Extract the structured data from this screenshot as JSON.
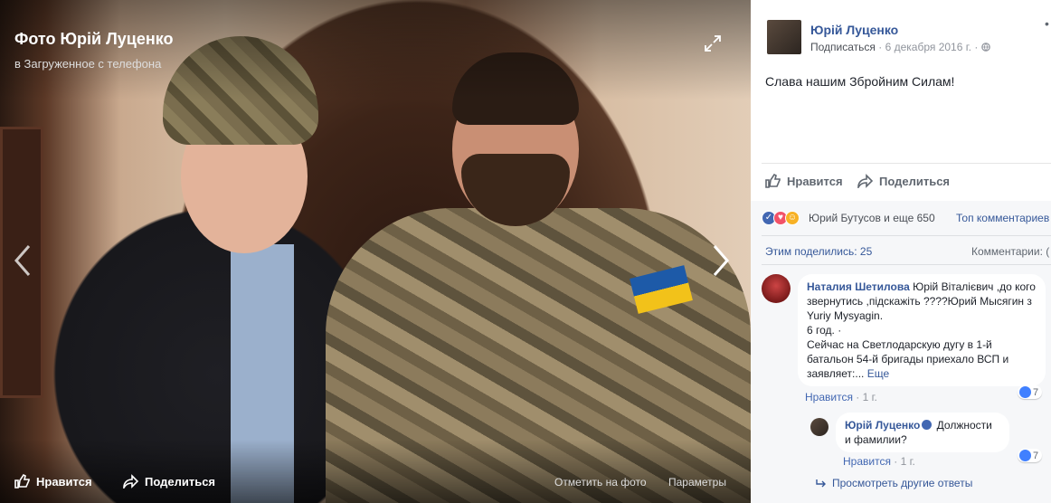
{
  "photo": {
    "title": "Фото Юрій Луценко",
    "subtitle": "в Загруженное с телефона",
    "bottom_bar": {
      "like_label": "Нравится",
      "share_label": "Поделиться",
      "tag_label": "Отметить на фото",
      "options_label": "Параметры"
    }
  },
  "post": {
    "author": "Юрій Луценко",
    "subscribe_label": "Подписаться",
    "date": "6 декабря 2016 г.",
    "separator": "·",
    "text": "Слава нашим Збройним Силам!",
    "like_label": "Нравится",
    "share_label": "Поделиться",
    "reactors": "Юрий Бутусов и еще 650",
    "top_comments_label": "Топ комментариев",
    "shared_label": "Этим поделились: 25",
    "comments_label": "Комментарии: ("
  },
  "comments": [
    {
      "author": "Наталия Шетилова",
      "text_before": " Юрій Віталієвич ,до кого звернутись ,підскажіть ????Юрий Мысягин з Yuriy Mysyagin.",
      "line2": "6 год. ·",
      "line3": "Сейчас на Светлодарскую дугу в 1-й батальон 54-й бригады приехало ВСП и заявляет:...",
      "more_label": "Еще",
      "like_label": "Нравится",
      "time": "· 1 г.",
      "likes": "7"
    },
    {
      "author": "Юрій Луценко",
      "text": " Должности и фамилии?",
      "like_label": "Нравится",
      "time": "· 1 г.",
      "likes": "7"
    }
  ],
  "view_more_replies": "Просмотреть другие ответы",
  "colors": {
    "link": "#365899",
    "like_blue": "#4267b2",
    "reaction_love": "#f25268",
    "reaction_haha": "#f7b125"
  }
}
